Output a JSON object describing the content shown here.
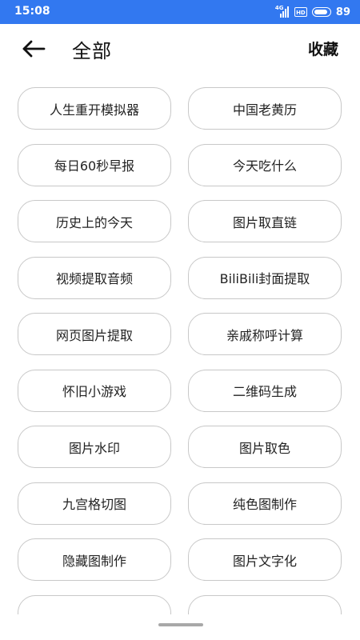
{
  "status_bar": {
    "time": "15:08",
    "network_label": "4G",
    "hd_label": "HD",
    "battery": "89",
    "battery_level": 0.89
  },
  "header": {
    "title": "全部",
    "favorites_label": "收藏",
    "back_icon": "arrow-left-icon"
  },
  "tools": [
    "人生重开模拟器",
    "中国老黄历",
    "每日60秒早报",
    "今天吃什么",
    "历史上的今天",
    "图片取直链",
    "视频提取音频",
    "BiliBili封面提取",
    "网页图片提取",
    "亲戚称呼计算",
    "怀旧小游戏",
    "二维码生成",
    "图片水印",
    "图片取色",
    "九宫格切图",
    "纯色图制作",
    "隐藏图制作",
    "图片文字化",
    "",
    ""
  ],
  "colors": {
    "status_bar": "#3278f0",
    "button_border": "#c8c8c8",
    "text": "#222222"
  }
}
